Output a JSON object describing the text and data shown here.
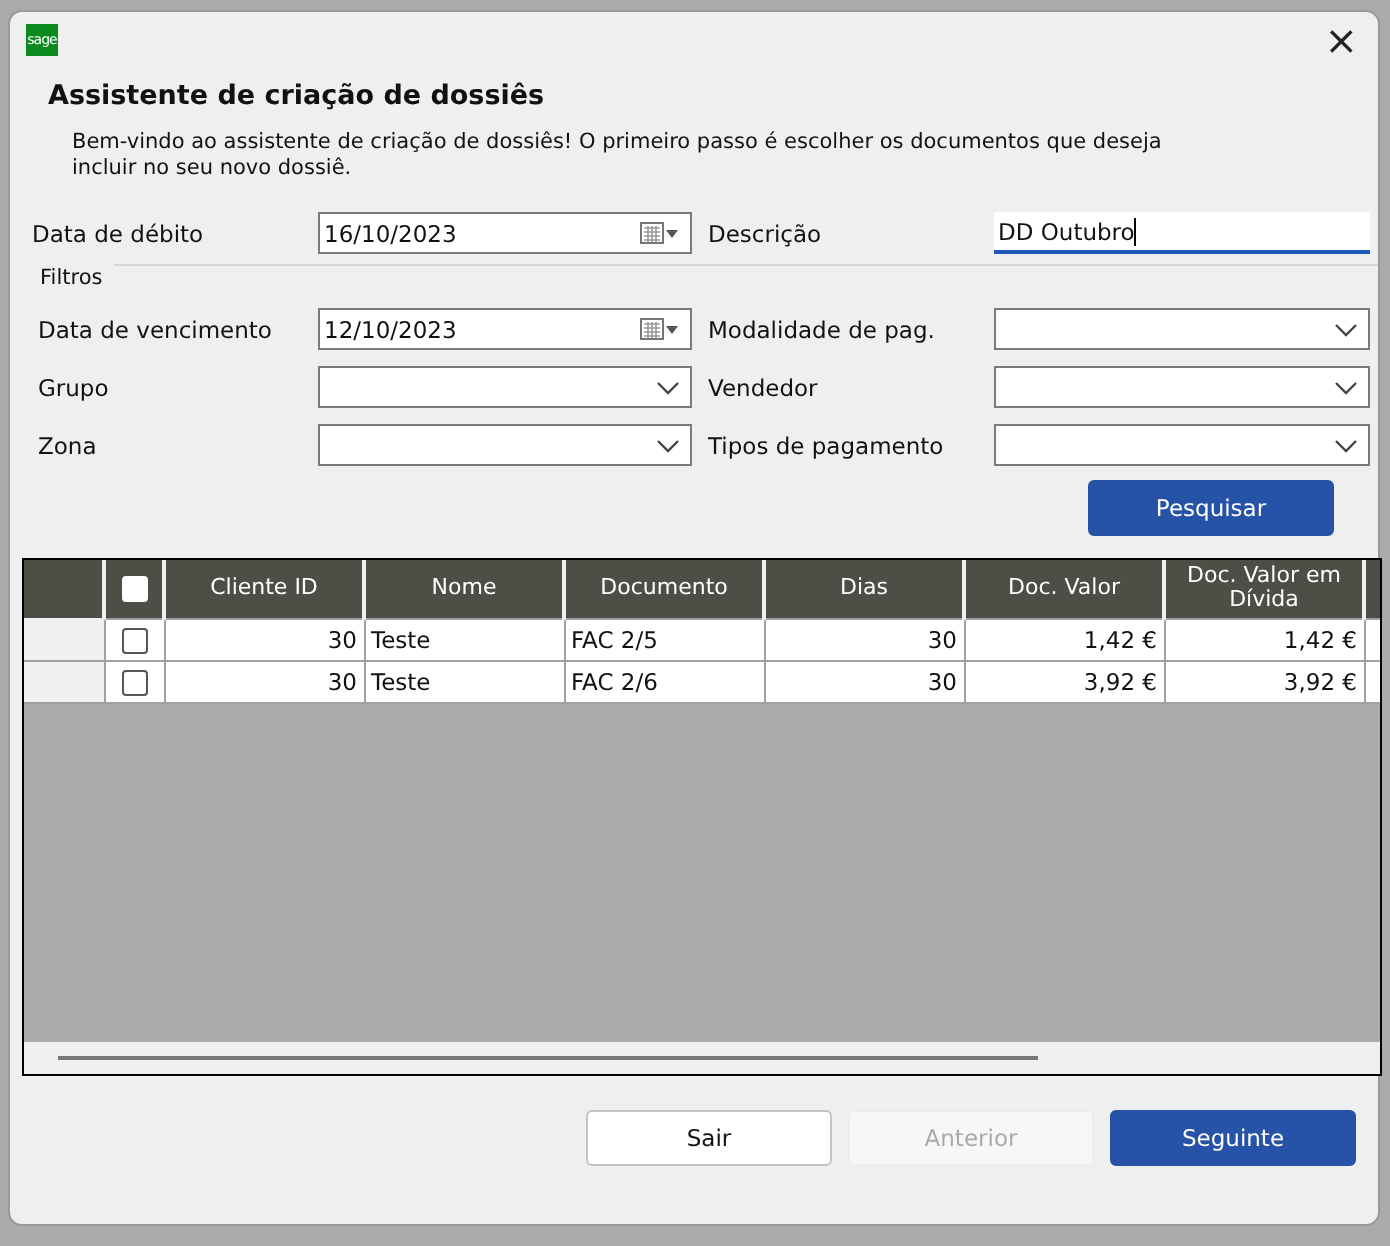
{
  "window": {
    "logo_text": "sage",
    "close": "×"
  },
  "heading": "Assistente de criação de dossiês",
  "intro": "Bem-vindo ao assistente de criação de dossiês! O primeiro passo é escolher os documentos que deseja incluir no seu novo dossiê.",
  "top_fields": [
    {
      "label": "Data de débito",
      "kind": "date",
      "value": "16/10/2023"
    },
    {
      "label": "Descrição",
      "kind": "text",
      "value": "DD Outubro",
      "focused": true
    }
  ],
  "filters": {
    "title": "Filtros",
    "fields": [
      {
        "label": "Data de vencimento",
        "kind": "date",
        "value": "12/10/2023"
      },
      {
        "label": "Modalidade de pag.",
        "kind": "combo"
      },
      {
        "label": "Grupo",
        "kind": "combo"
      },
      {
        "label": "Vendedor",
        "kind": "combo"
      },
      {
        "label": "Zona",
        "kind": "combo"
      },
      {
        "label": "Tipos de pagamento",
        "kind": "combo"
      }
    ],
    "search_button": "Pesquisar"
  },
  "table": {
    "columns": [
      "Cliente ID",
      "Nome",
      "Documento",
      "Dias",
      "Doc. Valor",
      "Doc. Valor em Dívida"
    ],
    "header_checked": false,
    "rows": [
      {
        "checked": false,
        "cells": [
          "30",
          "Teste",
          "FAC 2/5",
          "30",
          "1,42 €",
          "1,42 €"
        ]
      },
      {
        "checked": false,
        "cells": [
          "30",
          "Teste",
          "FAC 2/6",
          "30",
          "3,92 €",
          "3,92 €"
        ]
      }
    ]
  },
  "buttons": [
    {
      "label": "Sair",
      "kind": "default",
      "disabled": false
    },
    {
      "label": "Anterior",
      "kind": "default",
      "disabled": true
    },
    {
      "label": "Seguinte",
      "kind": "primary",
      "disabled": false
    }
  ]
}
